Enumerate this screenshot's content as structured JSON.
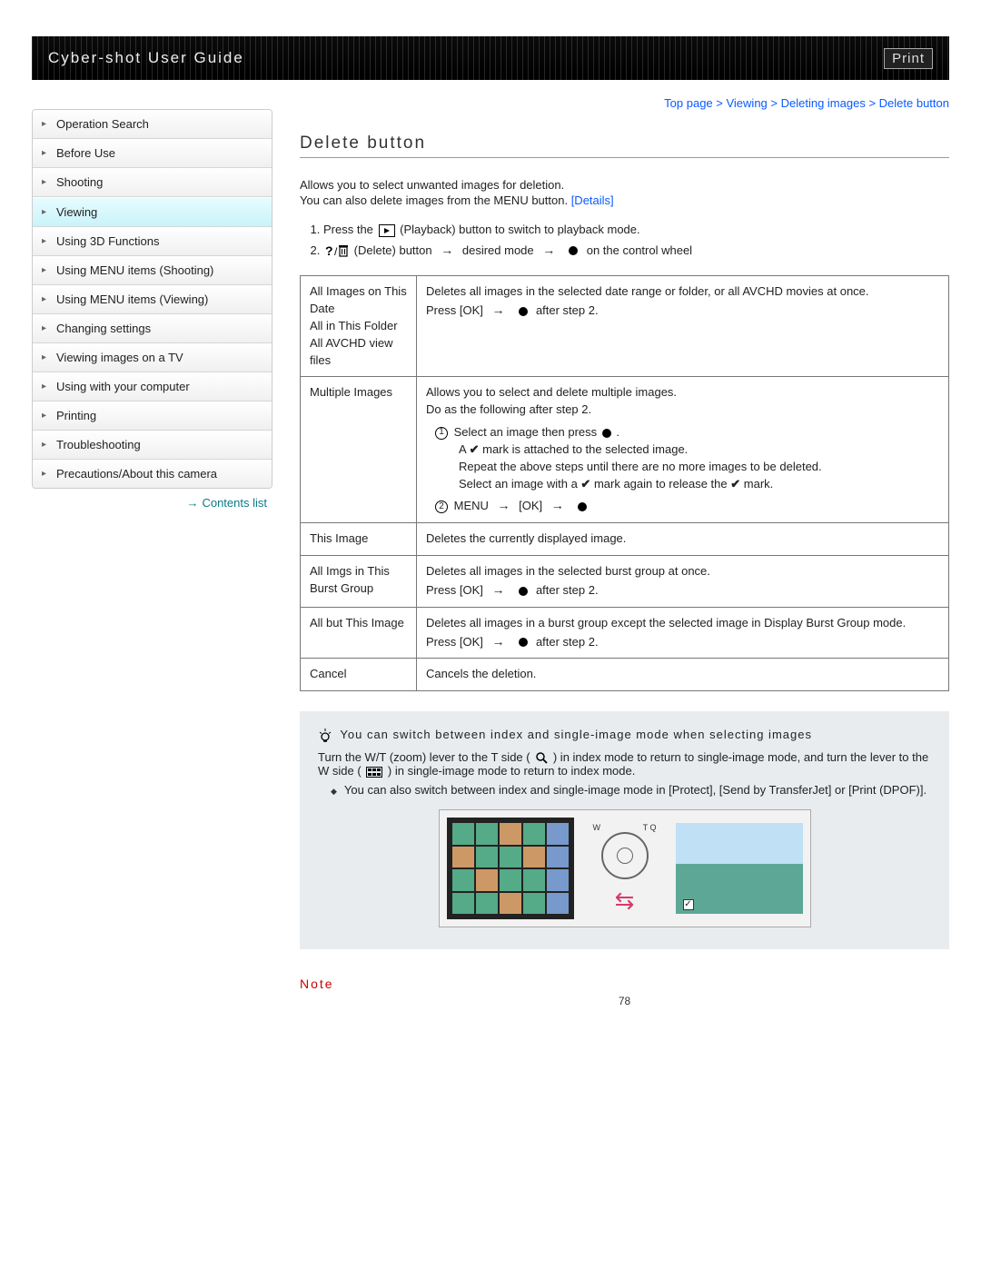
{
  "header": {
    "title": "Cyber-shot User Guide",
    "print": "Print"
  },
  "breadcrumb": [
    "Top page",
    "Viewing",
    "Deleting images",
    "Delete button"
  ],
  "sidebar": {
    "items": [
      {
        "label": "Operation Search",
        "active": false
      },
      {
        "label": "Before Use",
        "active": false
      },
      {
        "label": "Shooting",
        "active": false
      },
      {
        "label": "Viewing",
        "active": true
      },
      {
        "label": "Using 3D Functions",
        "active": false
      },
      {
        "label": "Using MENU items (Shooting)",
        "active": false
      },
      {
        "label": "Using MENU items (Viewing)",
        "active": false
      },
      {
        "label": "Changing settings",
        "active": false
      },
      {
        "label": "Viewing images on a TV",
        "active": false
      },
      {
        "label": "Using with your computer",
        "active": false
      },
      {
        "label": "Printing",
        "active": false
      },
      {
        "label": "Troubleshooting",
        "active": false
      },
      {
        "label": "Precautions/About this camera",
        "active": false
      }
    ],
    "contents_link": "Contents list"
  },
  "page": {
    "title": "Delete button",
    "intro1": "Allows you to select unwanted images for deletion.",
    "intro2_a": "You can also delete images from the MENU button. ",
    "intro2_details": "[Details]",
    "step1_a": "Press the ",
    "step1_b": " (Playback) button to switch to playback mode.",
    "step2_b": " (Delete) button ",
    "step2_c": " desired mode ",
    "step2_d": " on the control wheel",
    "table": [
      {
        "name": "All Images on This Date\nAll in This Folder\nAll AVCHD view files",
        "desc_a": "Deletes all images in the selected date range or folder, or all AVCHD movies at once.",
        "desc_b": "Press [OK] ",
        "desc_c": " after step 2."
      },
      {
        "name": "Multiple Images",
        "mi_intro_a": "Allows you to select and delete multiple images.",
        "mi_intro_b": "Do as the following after step 2.",
        "mi_s1_a": "Select an image then press ",
        "mi_s1_b": ".",
        "mi_s1_sub_a": "A ",
        "mi_s1_sub_b": " mark is attached to the selected image.",
        "mi_s1_sub2": "Repeat the above steps until there are no more images to be deleted.",
        "mi_s1_sub3_a": "Select an image with a ",
        "mi_s1_sub3_b": " mark again to release the ",
        "mi_s1_sub3_c": " mark.",
        "mi_s2_a": "MENU ",
        "mi_s2_b": " [OK] "
      },
      {
        "name": "This Image",
        "desc": "Deletes the currently displayed image."
      },
      {
        "name": "All Imgs in This Burst Group",
        "desc_a": "Deletes all images in the selected burst group at once.",
        "desc_b": "Press [OK] ",
        "desc_c": " after step 2."
      },
      {
        "name": "All but This Image",
        "desc_a": "Deletes all images in a burst group except the selected image in Display Burst Group mode.",
        "desc_b": "Press [OK] ",
        "desc_c": " after step 2."
      },
      {
        "name": "Cancel",
        "desc": "Cancels the deletion."
      }
    ],
    "tip": {
      "heading": "You can switch between index and single-image mode when selecting images",
      "body_a": "Turn the W/T (zoom) lever to the T side (",
      "body_b": ") in index mode to return to single-image mode, and turn the lever to the W side (",
      "body_c": ") in single-image mode to return to index mode.",
      "bullet": "You can also switch between index and single-image mode in [Protect], [Send by TransferJet] or [Print (DPOF)].",
      "dial_left": "W",
      "dial_right": "T Q"
    },
    "note_heading": "Note",
    "page_number": "78"
  }
}
